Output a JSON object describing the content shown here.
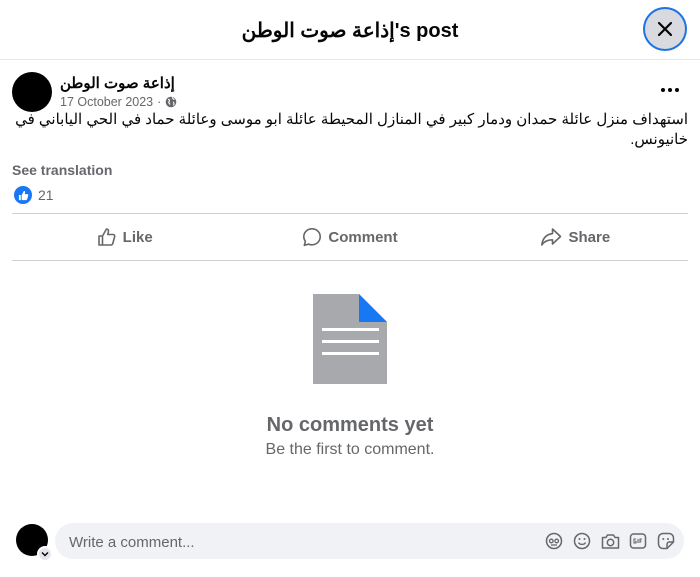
{
  "header": {
    "title": "إذاعة صوت الوطن's post"
  },
  "post": {
    "author": "إذاعة صوت الوطن",
    "date": "17 October 2023",
    "separator": "·",
    "text": "استهداف منزل عائلة حمدان ودمار كبير في المنازل المحيطة عائلة ابو موسى وعائلة حماد في الحي الياباني في خانيونس.",
    "see_translation": "See translation",
    "reaction_count": "21"
  },
  "actions": {
    "like": "Like",
    "comment": "Comment",
    "share": "Share"
  },
  "empty_state": {
    "title": "No comments yet",
    "subtitle": "Be the first to comment."
  },
  "composer": {
    "placeholder": "Write a comment..."
  },
  "colors": {
    "accent": "#1877f2",
    "muted": "#65676b",
    "doc_gray": "#a7a9ad"
  }
}
